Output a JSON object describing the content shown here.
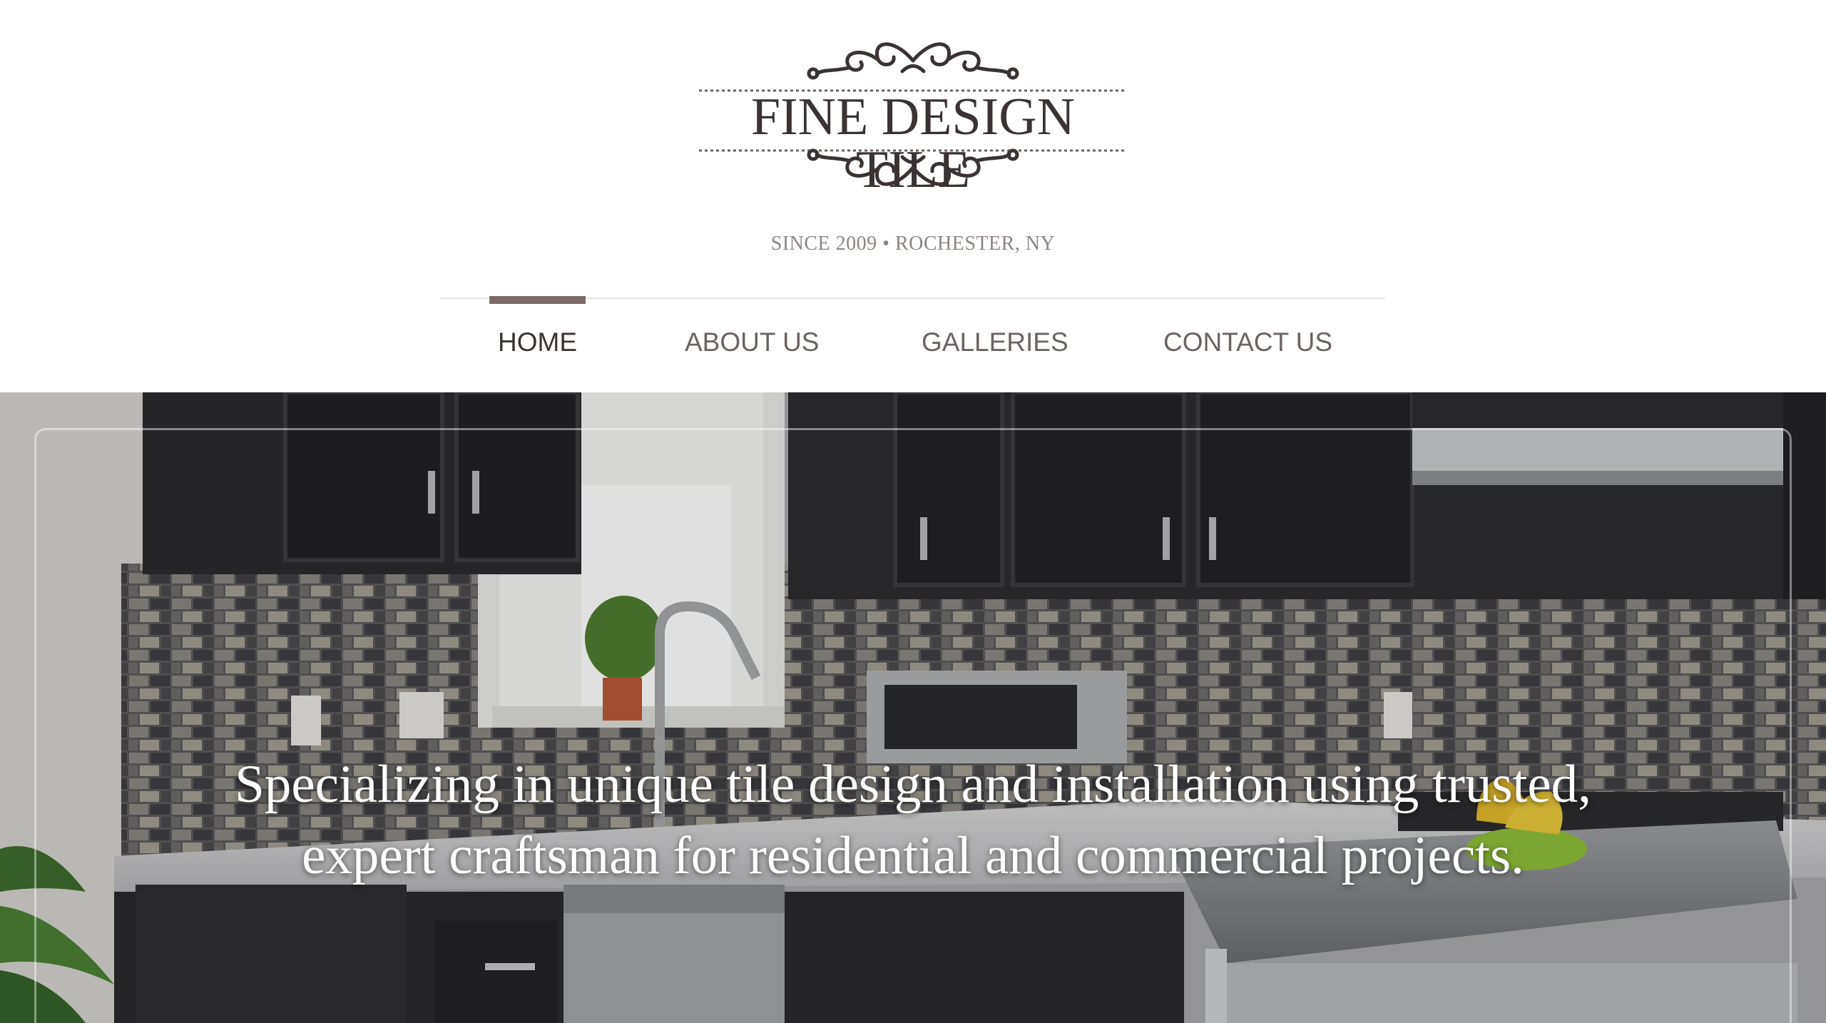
{
  "brand": {
    "name": "FINE DESIGN TILE",
    "tagline": "SINCE 2009 • ROCHESTER, NY"
  },
  "nav": {
    "items": [
      {
        "label": "HOME",
        "active": true
      },
      {
        "label": "ABOUT US",
        "active": false
      },
      {
        "label": "GALLERIES",
        "active": false
      },
      {
        "label": "CONTACT US",
        "active": false
      }
    ]
  },
  "hero": {
    "headline": "Specializing in unique tile design and installation using trusted, expert craftsman for residential and commercial projects."
  },
  "colors": {
    "nav_active_bar": "#7b6a65",
    "nav_text": "#6b6362",
    "logo_text": "#3a3233",
    "tagline": "#8c8584"
  }
}
